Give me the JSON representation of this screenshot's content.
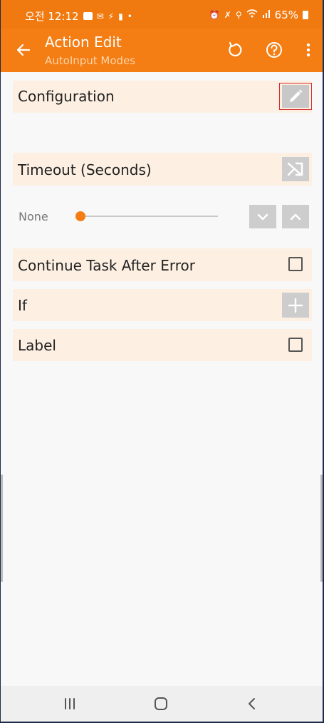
{
  "status_bar": {
    "time": "오전 12:12",
    "battery": "65%",
    "left_icons": [
      "news-icon",
      "mail-icon",
      "bolt-icon",
      "media-icon",
      "dot-icon"
    ],
    "right_icons": [
      "alarm-icon",
      "mute-icon",
      "location-icon",
      "wifi-icon",
      "signal-icon",
      "battery-icon"
    ]
  },
  "toolbar": {
    "title": "Action Edit",
    "subtitle": "AutoInput Modes",
    "icons": [
      "back-arrow-icon",
      "undo-icon",
      "help-icon",
      "more-vert-icon"
    ]
  },
  "rows": {
    "configuration": {
      "label": "Configuration",
      "icon": "pencil-icon"
    },
    "timeout": {
      "label": "Timeout (Seconds)",
      "icon": "shuffle-icon"
    },
    "timeout_slider": {
      "value_text": "None",
      "value": 0
    },
    "continue_task": {
      "label": "Continue Task After Error",
      "checked": false
    },
    "if_row": {
      "label": "If",
      "icon": "plus-icon"
    },
    "label_row": {
      "label": "Label",
      "checked": false
    }
  },
  "colors": {
    "accent": "#f47d14",
    "status_bar": "#f07a10",
    "row_background": "#fdf0e2",
    "highlight_border": "#d32f2f"
  },
  "nav_bar": {
    "icons": [
      "recent-apps-icon",
      "home-icon",
      "back-icon"
    ]
  }
}
